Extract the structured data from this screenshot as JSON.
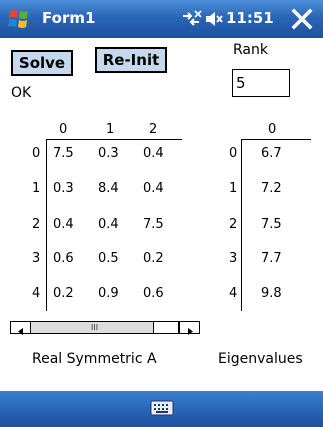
{
  "titlebar": {
    "title": "Form1",
    "clock": "11:51",
    "icons": [
      "windows-start-icon",
      "connectivity-icon",
      "volume-muted-icon",
      "close-icon"
    ]
  },
  "buttons": {
    "solve": "Solve",
    "reinit": "Re-Init"
  },
  "status": "OK",
  "rank": {
    "label": "Rank",
    "value": "5"
  },
  "matrix": {
    "column_headers": [
      "0",
      "1",
      "2"
    ],
    "row_headers": [
      "0",
      "1",
      "2",
      "3",
      "4"
    ],
    "rows": [
      [
        "7.5",
        "0.3",
        "0.4"
      ],
      [
        "0.3",
        "8.4",
        "0.4"
      ],
      [
        "0.4",
        "0.4",
        "7.5"
      ],
      [
        "0.6",
        "0.5",
        "0.2"
      ],
      [
        "0.2",
        "0.9",
        "0.6"
      ]
    ],
    "caption": "Real Symmetric A"
  },
  "eigen": {
    "column_headers": [
      "0"
    ],
    "row_headers": [
      "0",
      "1",
      "2",
      "3",
      "4"
    ],
    "values": [
      "6.7",
      "7.2",
      "7.5",
      "7.7",
      "9.8"
    ],
    "caption": "Eigenvalues"
  },
  "scrollbar": {
    "grip": "III"
  },
  "colors": {
    "titlebar": "#2a66b8",
    "button_fill": "#c5d8ee",
    "text": "#000000",
    "bar_text": "#ffffff"
  }
}
